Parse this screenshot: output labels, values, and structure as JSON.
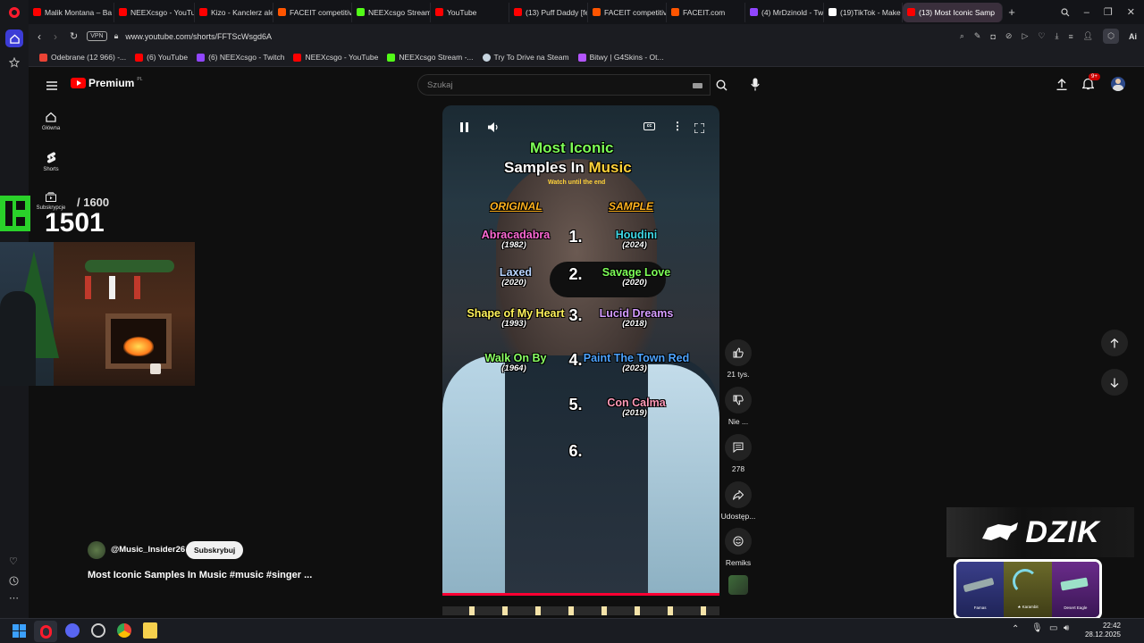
{
  "browser": {
    "tabs": [
      {
        "title": "Malik Montana – Ba",
        "color": "#ff0000"
      },
      {
        "title": "NEEXcsgo - YouTub",
        "color": "#ff0000"
      },
      {
        "title": "Kizo - Kanclerz ale t",
        "color": "#ff0000"
      },
      {
        "title": "FACEIT competitive",
        "color": "#ff5500"
      },
      {
        "title": "NEEXcsgo Stream -",
        "color": "#53fc18"
      },
      {
        "title": "YouTube",
        "color": "#ff0000"
      },
      {
        "title": "(13) Puff Daddy [fe",
        "color": "#ff0000"
      },
      {
        "title": "FACEIT competitive",
        "color": "#ff5500"
      },
      {
        "title": "FACEIT.com",
        "color": "#ff5500"
      },
      {
        "title": "(4) MrDzinold - Twi",
        "color": "#9146ff"
      },
      {
        "title": "(19)TikTok - Make Y",
        "color": "#ffffff"
      },
      {
        "title": "(13) Most Iconic Samp",
        "color": "#ff0000"
      }
    ],
    "url": "www.youtube.com/shorts/FFTScWsgd6A",
    "vpn_label": "VPN",
    "ai_label": "Ai",
    "bookmarks": [
      {
        "label": "Odebrane (12 966) -...",
        "color": "#ea4335"
      },
      {
        "label": "(6) YouTube",
        "color": "#ff0000"
      },
      {
        "label": "(6) NEEXcsgo - Twitch",
        "color": "#9146ff"
      },
      {
        "label": "NEEXcsgo - YouTube",
        "color": "#ff0000"
      },
      {
        "label": "NEEXcsgo Stream -...",
        "color": "#53fc18"
      },
      {
        "label": "Try To Drive na Steam",
        "color": "#c7d5e0"
      },
      {
        "label": "Bitwy | G4Skins - Ot...",
        "color": "#b455ff"
      }
    ]
  },
  "youtube": {
    "logo_text": "Premium",
    "logo_badge": "PL",
    "search_placeholder": "Szukaj",
    "notification_count": "9+",
    "sidebar": {
      "home": "Główna",
      "shorts": "Shorts",
      "subscriptions": "Subskrypcje"
    },
    "channel": {
      "handle": "@Music_Insider26",
      "subscribe": "Subskrybuj"
    },
    "video_title": "Most Iconic Samples In Music #music #singer ...",
    "actions": {
      "likes": "21 tys.",
      "dislike": "Nie ...",
      "comments": "278",
      "share": "Udostęp...",
      "remix": "Remiks"
    }
  },
  "video": {
    "title_line1": "Most Iconic",
    "title_line2_a": "Samples In ",
    "title_line2_b": "Music",
    "subtitle": "Watch until the end",
    "header_original": "ORIGINAL",
    "header_sample": "SAMPLE",
    "rows": [
      {
        "num": "1.",
        "orig": "Abracadabra",
        "orig_year": "(1982)",
        "orig_color": "#ff6ad5",
        "samp": "Houdini",
        "samp_year": "(2024)",
        "samp_color": "#3fd8e6"
      },
      {
        "num": "2.",
        "orig": "Laxed",
        "orig_year": "(2020)",
        "orig_color": "#b8d4ff",
        "samp": "Savage Love",
        "samp_year": "(2020)",
        "samp_color": "#7dff57"
      },
      {
        "num": "3.",
        "orig": "Shape of My Heart",
        "orig_year": "(1993)",
        "orig_color": "#fff35a",
        "samp": "Lucid Dreams",
        "samp_year": "(2018)",
        "samp_color": "#d59cff"
      },
      {
        "num": "4.",
        "orig": "Walk On By",
        "orig_year": "(1964)",
        "orig_color": "#8aff63",
        "samp": "Paint The Town Red",
        "samp_year": "(2023)",
        "samp_color": "#4da3ff"
      },
      {
        "num": "5.",
        "orig": "",
        "orig_year": "",
        "orig_color": "#ffffff",
        "samp": "Con Calma",
        "samp_year": "(2019)",
        "samp_color": "#ff9ab8"
      },
      {
        "num": "6.",
        "orig": "",
        "orig_year": "",
        "orig_color": "#ffffff",
        "samp": "",
        "samp_year": "",
        "samp_color": "#ffffff"
      }
    ]
  },
  "overlay": {
    "counter_total": "/ 1600",
    "counter_value": "1501",
    "sponsor": "DZIK",
    "skins": [
      "Famas",
      "★ Karambit",
      "Desert Eagle"
    ]
  },
  "taskbar": {
    "time": "22:42",
    "date": "28.12.2025"
  }
}
